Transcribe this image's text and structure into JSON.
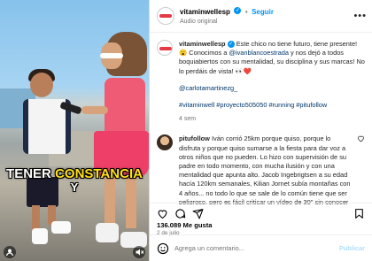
{
  "post": {
    "username": "vitaminwellesp",
    "follow_label": "Seguir",
    "subtitle": "Audio original",
    "caption_user": "vitaminwellesp",
    "caption_text_1": "Este chico no tiene futuro, tiene presente! 😮 Conocimos a ",
    "mention_1": "@ivanblancoestrada",
    "caption_text_2": " y nos dejó a todos boquiabiertos con su mentalidad, su disciplina y sus marcas! No lo perdáis de vista! 👀❤️",
    "mention_2": "@carlotamartinezg_",
    "hashtags": "#vitaminwell #proyecto505050 #running #pitufollow",
    "age": "4 sem",
    "comment_user": "pitufollow",
    "comment_text": "Iván corrió 25km porque quiso, porque lo disfruta y porque quiso sumarse a la fiesta para dar voz a otros niños que no pueden. Lo hizo con supervisión de su padre en todo momento, con mucha ilusión y con una mentalidad que apunta alto. Jacob Ingebrigtsen a su edad hacía 120km semanales, Kilian Jornet subía montañas con 4 años... no todo lo que se sale de lo común tiene que ser peligroso, pero es fácil criticar un vídeo de 30'' sin conocer la historia ni el contexto. A veces lo más sano, puede que sea no opinar. Mis",
    "likes": "136.089 Me gusta",
    "date": "2 de julio",
    "add_comment_placeholder": "Agrega un comentario...",
    "publish_label": "Publicar"
  },
  "video": {
    "caption_word_1": "TENER",
    "caption_word_2": "CONSTANCIA",
    "caption_word_3": "Y"
  },
  "icons": {
    "like": "heart-icon",
    "comment": "comment-icon",
    "share": "share-icon",
    "save": "bookmark-icon",
    "more": "more-options-icon",
    "emoji": "emoji-icon",
    "mute": "mute-icon",
    "tag": "tag-people-icon"
  },
  "colors": {
    "accent": "#0095f6",
    "link": "#00376b",
    "muted": "#737373"
  }
}
